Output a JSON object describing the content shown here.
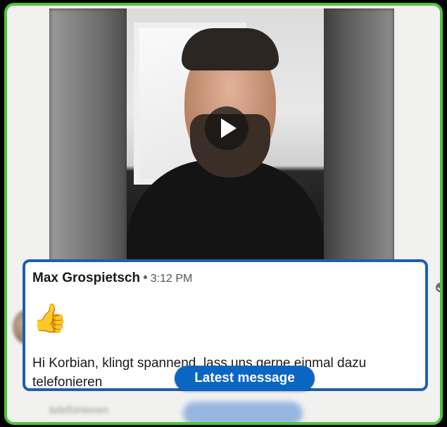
{
  "message": {
    "sender": "Max Grospietsch",
    "separator": "•",
    "time": "3:12 PM",
    "emoji": "👍",
    "text": "Hi Korbian, klingt spannend, lass uns gerne einmal dazu telefonieren"
  },
  "latest_message_button": "Latest message",
  "background_text": "telefonieren",
  "colors": {
    "frame_border": "#4cc63a",
    "card_border": "#1d5fb0",
    "pill": "#0a66c2"
  },
  "icons": [
    "play-icon",
    "read-receipt-icon"
  ]
}
